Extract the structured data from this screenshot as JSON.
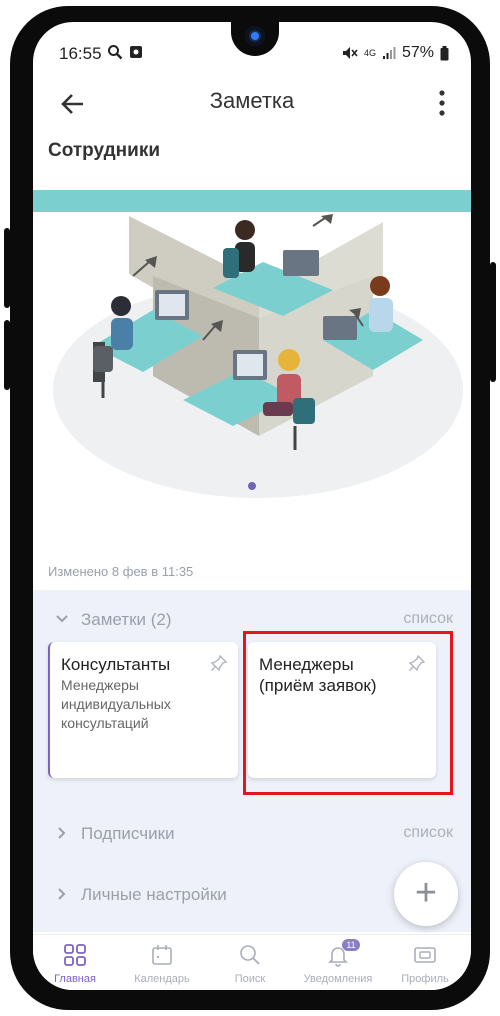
{
  "status": {
    "time": "16:55",
    "network": "4G",
    "battery": "57%"
  },
  "appbar": {
    "title": "Заметка"
  },
  "page": {
    "title": "Сотрудники",
    "modified": "Изменено 8 фев в 11:35"
  },
  "sections": {
    "notes": {
      "label": "Заметки (2)",
      "action": "список"
    },
    "subscribers": {
      "label": "Подписчики",
      "action": "список"
    },
    "personal": {
      "label": "Личные настройки"
    }
  },
  "cards": [
    {
      "title": "Консультанты",
      "subtitle": "Менеджеры индивидуальных консультаций",
      "accent": "#7b63c6"
    },
    {
      "title": "Менеджеры (приём заявок)",
      "subtitle": ""
    }
  ],
  "fab": {
    "label": "+"
  },
  "nav": {
    "items": [
      {
        "label": "Главная",
        "icon": "grid-icon",
        "active": true
      },
      {
        "label": "Календарь",
        "icon": "calendar-icon"
      },
      {
        "label": "Поиск",
        "icon": "search-icon"
      },
      {
        "label": "Уведомления",
        "icon": "bell-icon",
        "badge": "11"
      },
      {
        "label": "Профиль",
        "icon": "profile-card-icon"
      }
    ]
  },
  "colors": {
    "accent": "#7b63c6",
    "highlight": "#e8141c",
    "teal": "#7ccfcf",
    "panel": "#eef1f9"
  }
}
